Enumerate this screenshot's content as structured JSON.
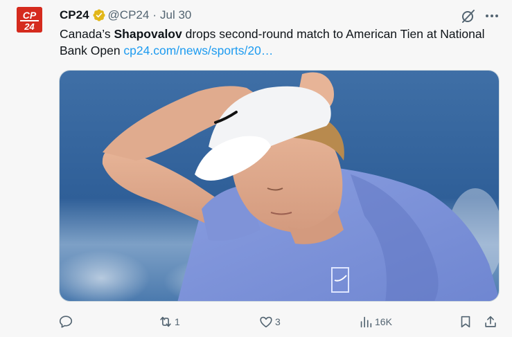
{
  "tweet": {
    "author_name": "CP24",
    "handle": "@CP24",
    "separator": "·",
    "date": "Jul 30",
    "avatar_text": "CP 24",
    "text_part1": "Canada’s ",
    "text_bold": "Shapovalov",
    "text_part2": " drops second-round match to American Tien at National Bank Open ",
    "link_text": "cp24.com/news/sports/20…",
    "media_icon": "photo-tennis-player"
  },
  "actions": {
    "reply_count": "",
    "repost_count": "1",
    "like_count": "3",
    "views_count": "16K",
    "icons": [
      "reply-icon",
      "repost-icon",
      "like-icon",
      "views-icon",
      "bookmark-icon",
      "share-icon"
    ]
  },
  "colors": {
    "brand_red": "#d52b1e",
    "link_blue": "#1d9bf0",
    "verified_gold": "#e2b719",
    "muted_gray": "#536471",
    "background": "#f7f7f7"
  }
}
